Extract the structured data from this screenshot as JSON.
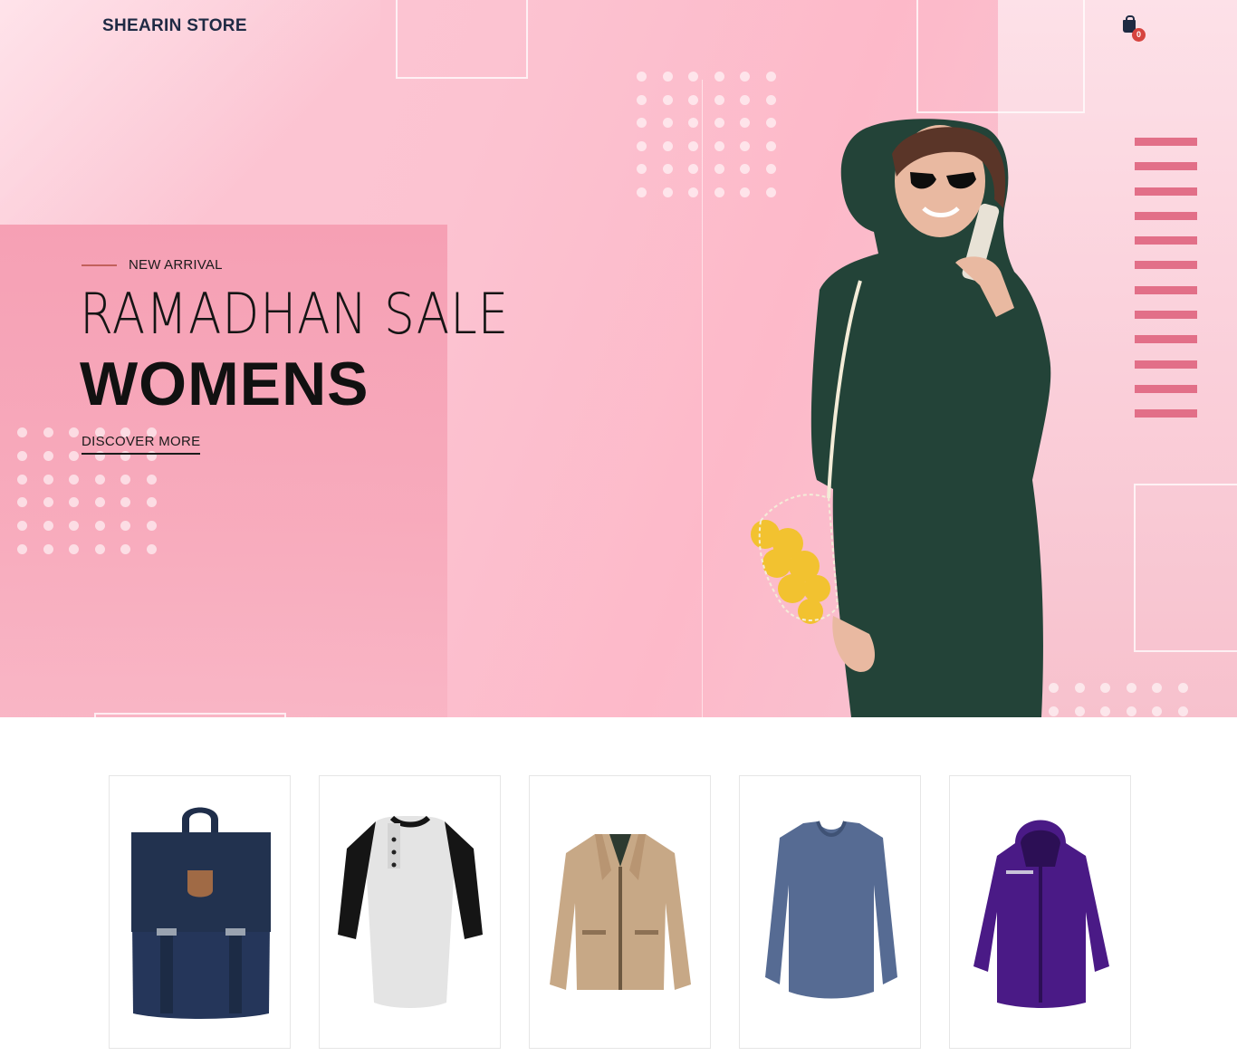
{
  "header": {
    "brand": "SHEARIN STORE",
    "cart_count": "0"
  },
  "hero": {
    "tag": "NEW ARRIVAL",
    "headline_light": "RAMADHAN SALE",
    "headline_bold": "WOMENS",
    "cta_label": "DISCOVER MORE"
  },
  "colors": {
    "accent": "#d6443f",
    "stripe": "#e26f88",
    "tag_line": "#c2615c"
  },
  "products": [
    {
      "name": "backpack-navy"
    },
    {
      "name": "raglan-henley-tee"
    },
    {
      "name": "khaki-jacket"
    },
    {
      "name": "blue-long-sleeve-tee"
    },
    {
      "name": "purple-hooded-jacket"
    }
  ]
}
